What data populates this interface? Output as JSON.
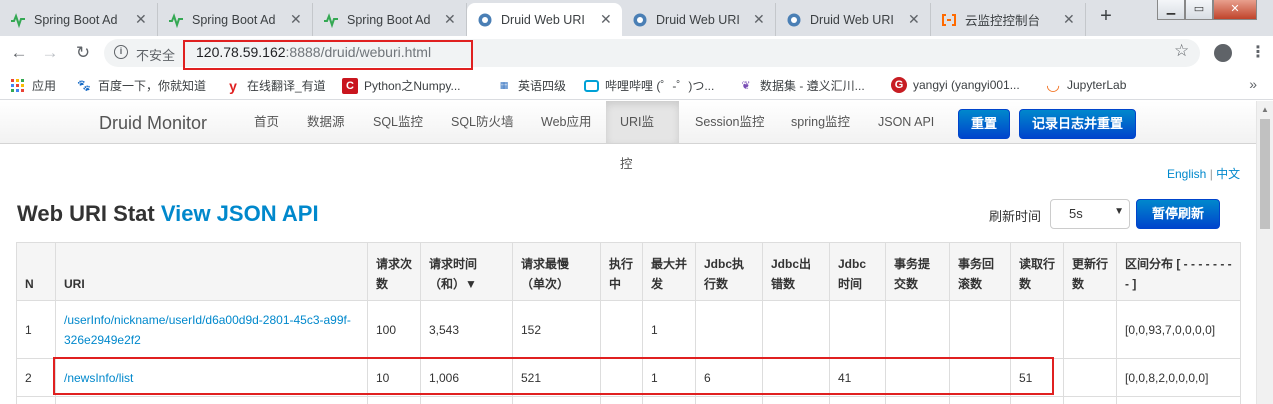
{
  "browser": {
    "tabs": [
      {
        "title": "Spring Boot Ad",
        "icon": "spring-icon",
        "active": false
      },
      {
        "title": "Spring Boot Ad",
        "icon": "spring-icon",
        "active": false
      },
      {
        "title": "Spring Boot Ad",
        "icon": "spring-icon",
        "active": false
      },
      {
        "title": "Druid Web URI",
        "icon": "druid-icon",
        "active": true
      },
      {
        "title": "Druid Web URI",
        "icon": "druid-icon",
        "active": false
      },
      {
        "title": "Druid Web URI",
        "icon": "druid-icon",
        "active": false
      },
      {
        "title": "云监控控制台",
        "icon": "aliyun-icon",
        "active": false
      }
    ],
    "new_tab": "+",
    "insecure_label": "不安全",
    "url_host": "120.78.59.162",
    "url_rest": ":8888/druid/weburi.html",
    "bookmarks": [
      {
        "label": "应用",
        "icon": "apps-grid-icon"
      },
      {
        "label": "百度一下，你就知道",
        "icon": "baidu-paw-icon"
      },
      {
        "label": "在线翻译_有道",
        "icon": "youdao-y-icon"
      },
      {
        "label": "Python之Numpy...",
        "icon": "bookmark-icon"
      },
      {
        "label": "英语四级",
        "icon": "english-icon"
      },
      {
        "label": "哔哩哔哩 (゜-゜)つ...",
        "icon": "bilibili-tv-icon"
      },
      {
        "label": "数据集 - 遵义汇川...",
        "icon": "dataset-icon"
      },
      {
        "label": "yangyi (yangyi001...",
        "icon": "gitee-g-icon"
      },
      {
        "label": "JupyterLab",
        "icon": "jupyter-icon"
      }
    ],
    "more_bookmarks": "»"
  },
  "druid": {
    "brand": "Druid Monitor",
    "nav": [
      "首页",
      "数据源",
      "SQL监控",
      "SQL防火墙",
      "Web应用",
      "URI监控",
      "Session监控",
      "spring监控",
      "JSON API"
    ],
    "active_nav": "URI监控",
    "reset_button": "重置",
    "log_reset_button": "记录日志并重置",
    "lang_en": "English",
    "lang_sep": "|",
    "lang_zh": "中文",
    "title_main": "Web URI Stat ",
    "title_link": "View JSON API",
    "refresh_label": "刷新时间",
    "refresh_value": "5s",
    "pause_button": "暂停刷新"
  },
  "table": {
    "headers": [
      "N",
      "URI",
      "请求次数",
      "请求时间（和）▼",
      "请求最慢（单次）",
      "执行中",
      "最大并发",
      "Jdbc执行数",
      "Jdbc出错数",
      "Jdbc时间",
      "事务提交数",
      "事务回滚数",
      "读取行数",
      "更新行数",
      "区间分布 [ - - - - - - - - ]"
    ],
    "rows": [
      [
        "1",
        "/userInfo/nickname/userId/d6a00d9d-2801-45c3-a99f-326e2949e2f2",
        "100",
        "3,543",
        "152",
        "",
        "1",
        "",
        "",
        "",
        "",
        "",
        "",
        "",
        "[0,0,93,7,0,0,0,0]"
      ],
      [
        "2",
        "/newsInfo/list",
        "10",
        "1,006",
        "521",
        "",
        "1",
        "6",
        "",
        "41",
        "",
        "",
        "51",
        "",
        "[0,0,8,2,0,0,0,0]"
      ]
    ]
  },
  "colors": {
    "accent": "#0088cc",
    "highlight": "#e02020"
  }
}
